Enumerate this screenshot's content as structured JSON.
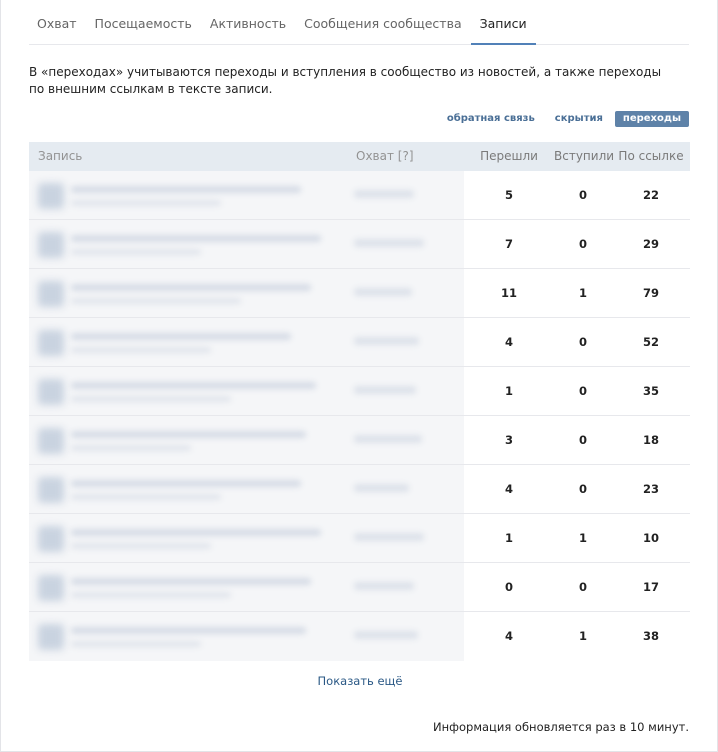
{
  "tabs": [
    {
      "label": "Охват"
    },
    {
      "label": "Посещаемость"
    },
    {
      "label": "Активность"
    },
    {
      "label": "Сообщения сообщества"
    },
    {
      "label": "Записи"
    }
  ],
  "active_tab": "Записи",
  "note": "В «переходах» учитываются переходы и вступления в сообщество из новостей, а также переходы по внешним ссылкам в тексте записи.",
  "filters": [
    {
      "label": "обратная связь"
    },
    {
      "label": "скрытия"
    },
    {
      "label": "переходы"
    }
  ],
  "active_filter": "переходы",
  "table": {
    "headers": {
      "post": "Запись",
      "reach": "Охват [?]",
      "clicked": "Перешли",
      "joined": "Вступили",
      "by_link": "По ссылке"
    },
    "rows": [
      {
        "clicked": "5",
        "joined": "0",
        "by_link": "22"
      },
      {
        "clicked": "7",
        "joined": "0",
        "by_link": "29"
      },
      {
        "clicked": "11",
        "joined": "1",
        "by_link": "79"
      },
      {
        "clicked": "4",
        "joined": "0",
        "by_link": "52"
      },
      {
        "clicked": "1",
        "joined": "0",
        "by_link": "35"
      },
      {
        "clicked": "3",
        "joined": "0",
        "by_link": "18"
      },
      {
        "clicked": "4",
        "joined": "0",
        "by_link": "23"
      },
      {
        "clicked": "1",
        "joined": "1",
        "by_link": "10"
      },
      {
        "clicked": "0",
        "joined": "0",
        "by_link": "17"
      },
      {
        "clicked": "4",
        "joined": "1",
        "by_link": "38"
      }
    ]
  },
  "show_more": "Показать ещё",
  "footer": "Информация обновляется раз в 10 минут.",
  "colors": {
    "accent": "#5181b8",
    "active_filter_bg": "#5e82a8",
    "link": "#2a5885",
    "header_bg": "#e5ebf1"
  }
}
